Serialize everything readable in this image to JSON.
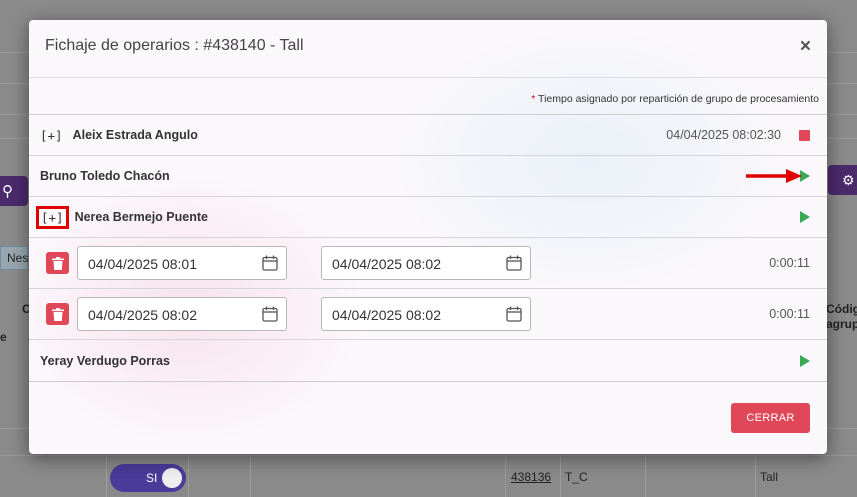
{
  "background": {
    "nes_label": "Nes",
    "col_c": "C",
    "col_e": "e",
    "codigo_header_1": "Códig",
    "codigo_header_2": "agrup",
    "toggle_label": "SI",
    "row_link": "438136",
    "row_code": "T_C",
    "row_tall": "Tall"
  },
  "modal": {
    "title": "Fichaje de operarios : #438140 - Tall",
    "close_icon": "×",
    "note_star": "*",
    "note_text": " Tiempo asignado por repartición de grupo de procesamiento",
    "operators": [
      {
        "expand": "[+]",
        "name": "Aleix Estrada Angulo",
        "timestamp": "04/04/2025 08:02:30",
        "action_icon": "stop-icon"
      },
      {
        "name": "Bruno Toledo Chacón",
        "action_icon": "play-icon"
      },
      {
        "expand": "[+]",
        "name": "Nerea Bermejo Puente",
        "action_icon": "play-icon"
      },
      {
        "name": "Yeray Verdugo Porras",
        "action_icon": "play-icon"
      }
    ],
    "time_entries": [
      {
        "start": "04/04/2025 08:01",
        "end": "04/04/2025 08:02",
        "duration": "0:00:11"
      },
      {
        "start": "04/04/2025 08:02",
        "end": "04/04/2025 08:02",
        "duration": "0:00:11"
      }
    ],
    "close_button": "CERRAR"
  },
  "colors": {
    "danger": "#e0485a",
    "play": "#3aa857",
    "highlight": "#e00000",
    "brand_purple": "#4b2a6b"
  }
}
